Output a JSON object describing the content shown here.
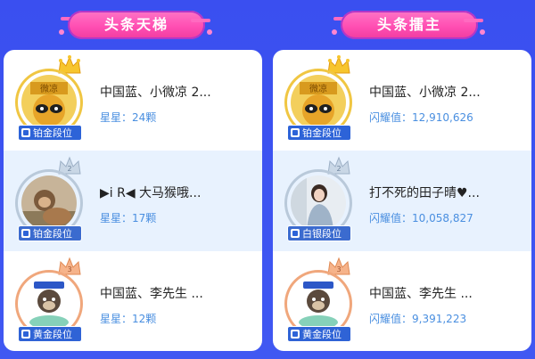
{
  "left": {
    "title": "头条天梯",
    "rows": [
      {
        "name": "中国蓝、小微凉 2...",
        "stat_label": "星星：",
        "stat_value": "24颗",
        "rank": "铂金段位",
        "avatar": "raccoon-avatar",
        "highlight": false,
        "tier": "gold"
      },
      {
        "name": "▶i R◀ 大马猴哦...",
        "stat_label": "星星：",
        "stat_value": "17颗",
        "rank": "铂金段位",
        "avatar": "monkey-avatar",
        "highlight": true,
        "tier": "silver"
      },
      {
        "name": "中国蓝、李先生 ...",
        "stat_label": "星星：",
        "stat_value": "12颗",
        "rank": "黄金段位",
        "avatar": "dog-avatar",
        "highlight": false,
        "tier": "bronze"
      }
    ]
  },
  "right": {
    "title": "头条擂主",
    "rows": [
      {
        "name": "中国蓝、小微凉 2...",
        "stat_label": "闪耀值：",
        "stat_value": "12,910,626",
        "rank": "铂金段位",
        "avatar": "raccoon-avatar",
        "highlight": false,
        "tier": "gold"
      },
      {
        "name": "打不死的田子晴♥...",
        "stat_label": "闪耀值：",
        "stat_value": "10,058,827",
        "rank": "白银段位",
        "avatar": "portrait-avatar",
        "highlight": true,
        "tier": "silver"
      },
      {
        "name": "中国蓝、李先生 ...",
        "stat_label": "闪耀值：",
        "stat_value": "9,391,223",
        "rank": "黄金段位",
        "avatar": "dog-avatar",
        "highlight": false,
        "tier": "bronze"
      }
    ]
  },
  "colors": {
    "background": "#3d54f0",
    "banner": "#ff4fb3",
    "stat_text": "#4a8fe0",
    "row_highlight": "#e8f2fe",
    "rank_badge": "#2d63d8"
  }
}
